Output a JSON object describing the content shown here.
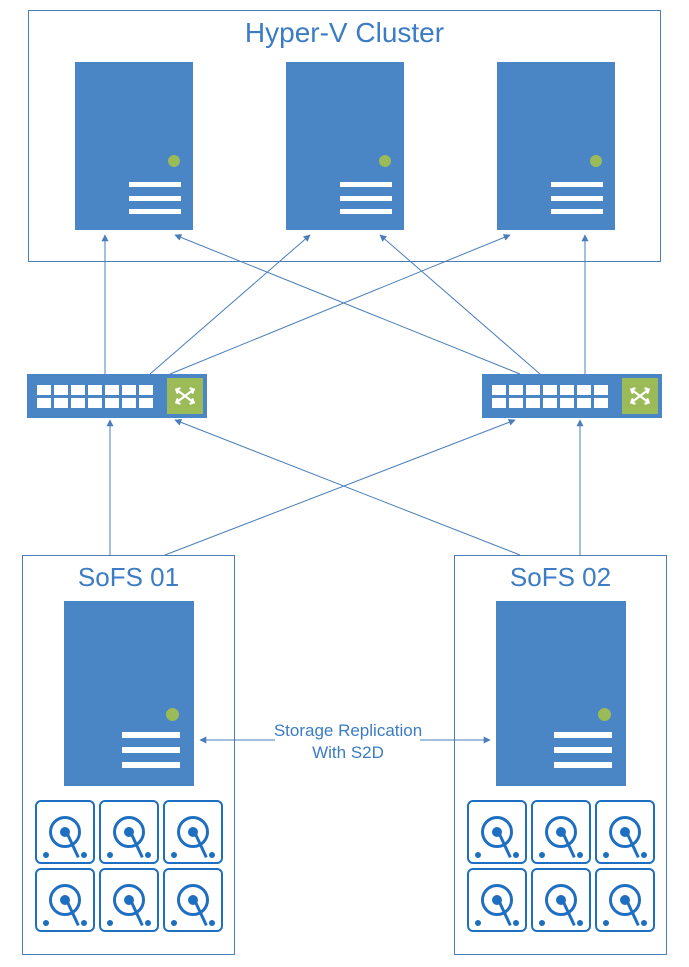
{
  "cluster": {
    "title": "Hyper-V Cluster"
  },
  "sofs": {
    "left": {
      "title": "SoFS 01"
    },
    "right": {
      "title": "SoFS 02"
    }
  },
  "replication": {
    "line1": "Storage Replication",
    "line2": "With S2D"
  },
  "icons": {
    "server": "server-icon",
    "switch": "network-switch-icon",
    "disk": "hard-disk-icon",
    "crossover": "crossover-icon"
  },
  "colors": {
    "primary": "#4a86c5",
    "border": "#4a7ebb",
    "accent_green": "#9bbb59",
    "disk_blue": "#1e6fc1"
  },
  "chart_data": {
    "type": "diagram",
    "title": "Hyper-V Cluster with SoFS S2D storage",
    "nodes": [
      {
        "id": "hv1",
        "type": "hyperv-host",
        "group": "Hyper-V Cluster"
      },
      {
        "id": "hv2",
        "type": "hyperv-host",
        "group": "Hyper-V Cluster"
      },
      {
        "id": "hv3",
        "type": "hyperv-host",
        "group": "Hyper-V Cluster"
      },
      {
        "id": "sw1",
        "type": "network-switch"
      },
      {
        "id": "sw2",
        "type": "network-switch"
      },
      {
        "id": "sofs1",
        "type": "sofs-node",
        "label": "SoFS 01",
        "disks": 6
      },
      {
        "id": "sofs2",
        "type": "sofs-node",
        "label": "SoFS 02",
        "disks": 6
      }
    ],
    "edges": [
      {
        "from": "sw1",
        "to": "hv1"
      },
      {
        "from": "sw1",
        "to": "hv2"
      },
      {
        "from": "sw1",
        "to": "hv3"
      },
      {
        "from": "sw2",
        "to": "hv1"
      },
      {
        "from": "sw2",
        "to": "hv2"
      },
      {
        "from": "sw2",
        "to": "hv3"
      },
      {
        "from": "sofs1",
        "to": "sw1"
      },
      {
        "from": "sofs1",
        "to": "sw2"
      },
      {
        "from": "sofs2",
        "to": "sw1"
      },
      {
        "from": "sofs2",
        "to": "sw2"
      },
      {
        "from": "sofs1",
        "to": "sofs2",
        "label": "Storage Replication With S2D",
        "bidirectional": true
      }
    ]
  }
}
